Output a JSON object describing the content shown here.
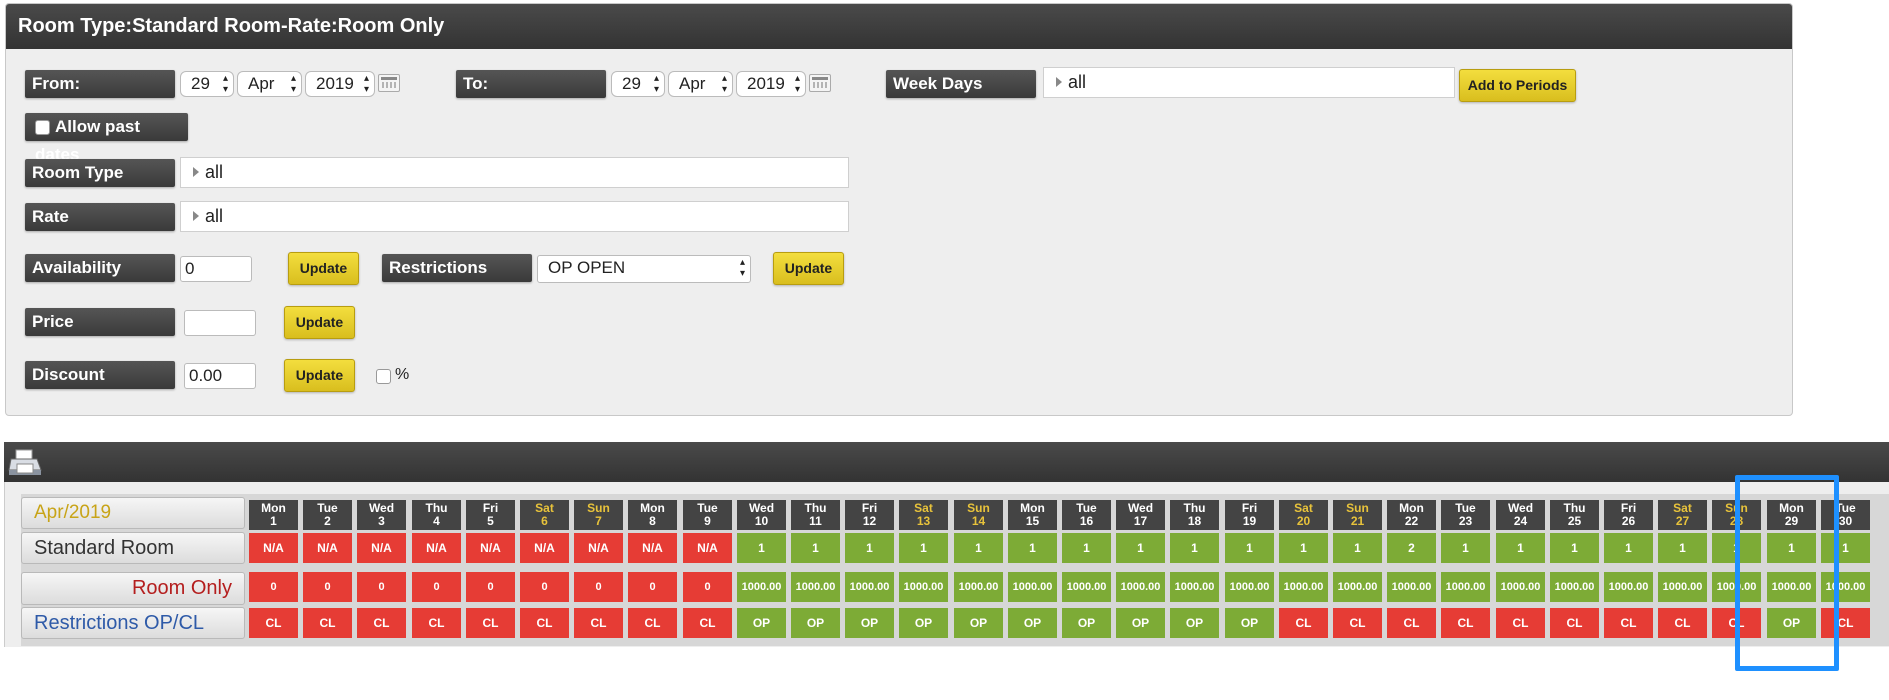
{
  "panel": {
    "title": "Room Type:Standard Room-Rate:Room Only"
  },
  "filters": {
    "from_label": "From:",
    "from_day": "29",
    "from_month": "Apr",
    "from_year": "2019",
    "to_label": "To:",
    "to_day": "29",
    "to_month": "Apr",
    "to_year": "2019",
    "weekdays_label": "Week Days",
    "weekdays_value": "all",
    "add_periods_label": "Add to Periods",
    "allow_past_label": "Allow past dates",
    "room_type_label": "Room Type",
    "room_type_value": "all",
    "rate_label": "Rate",
    "rate_value": "all"
  },
  "update_fields": {
    "availability_label": "Availability",
    "availability_value": "0",
    "update_label": "Update",
    "restrictions_label": "Restrictions",
    "restrictions_value": "OP OPEN",
    "price_label": "Price",
    "price_value": "",
    "discount_label": "Discount",
    "discount_value": "0.00",
    "percent_label": "%"
  },
  "grid": {
    "month_label": "Apr/2019",
    "room_label": "Standard Room",
    "rate_label": "Room Only",
    "restrictions_label": "Restrictions OP/CL",
    "days": [
      {
        "wd": "Mon",
        "d": "1",
        "weekend": false,
        "avail": "N/A",
        "price": "0",
        "rest": "CL"
      },
      {
        "wd": "Tue",
        "d": "2",
        "weekend": false,
        "avail": "N/A",
        "price": "0",
        "rest": "CL"
      },
      {
        "wd": "Wed",
        "d": "3",
        "weekend": false,
        "avail": "N/A",
        "price": "0",
        "rest": "CL"
      },
      {
        "wd": "Thu",
        "d": "4",
        "weekend": false,
        "avail": "N/A",
        "price": "0",
        "rest": "CL"
      },
      {
        "wd": "Fri",
        "d": "5",
        "weekend": false,
        "avail": "N/A",
        "price": "0",
        "rest": "CL"
      },
      {
        "wd": "Sat",
        "d": "6",
        "weekend": true,
        "avail": "N/A",
        "price": "0",
        "rest": "CL"
      },
      {
        "wd": "Sun",
        "d": "7",
        "weekend": true,
        "avail": "N/A",
        "price": "0",
        "rest": "CL"
      },
      {
        "wd": "Mon",
        "d": "8",
        "weekend": false,
        "avail": "N/A",
        "price": "0",
        "rest": "CL"
      },
      {
        "wd": "Tue",
        "d": "9",
        "weekend": false,
        "avail": "N/A",
        "price": "0",
        "rest": "CL"
      },
      {
        "wd": "Wed",
        "d": "10",
        "weekend": false,
        "avail": "1",
        "price": "1000.00",
        "rest": "OP"
      },
      {
        "wd": "Thu",
        "d": "11",
        "weekend": false,
        "avail": "1",
        "price": "1000.00",
        "rest": "OP"
      },
      {
        "wd": "Fri",
        "d": "12",
        "weekend": false,
        "avail": "1",
        "price": "1000.00",
        "rest": "OP"
      },
      {
        "wd": "Sat",
        "d": "13",
        "weekend": true,
        "avail": "1",
        "price": "1000.00",
        "rest": "OP"
      },
      {
        "wd": "Sun",
        "d": "14",
        "weekend": true,
        "avail": "1",
        "price": "1000.00",
        "rest": "OP"
      },
      {
        "wd": "Mon",
        "d": "15",
        "weekend": false,
        "avail": "1",
        "price": "1000.00",
        "rest": "OP"
      },
      {
        "wd": "Tue",
        "d": "16",
        "weekend": false,
        "avail": "1",
        "price": "1000.00",
        "rest": "OP"
      },
      {
        "wd": "Wed",
        "d": "17",
        "weekend": false,
        "avail": "1",
        "price": "1000.00",
        "rest": "OP"
      },
      {
        "wd": "Thu",
        "d": "18",
        "weekend": false,
        "avail": "1",
        "price": "1000.00",
        "rest": "OP"
      },
      {
        "wd": "Fri",
        "d": "19",
        "weekend": false,
        "avail": "1",
        "price": "1000.00",
        "rest": "OP"
      },
      {
        "wd": "Sat",
        "d": "20",
        "weekend": true,
        "avail": "1",
        "price": "1000.00",
        "rest": "CL"
      },
      {
        "wd": "Sun",
        "d": "21",
        "weekend": true,
        "avail": "1",
        "price": "1000.00",
        "rest": "CL"
      },
      {
        "wd": "Mon",
        "d": "22",
        "weekend": false,
        "avail": "2",
        "price": "1000.00",
        "rest": "CL"
      },
      {
        "wd": "Tue",
        "d": "23",
        "weekend": false,
        "avail": "1",
        "price": "1000.00",
        "rest": "CL"
      },
      {
        "wd": "Wed",
        "d": "24",
        "weekend": false,
        "avail": "1",
        "price": "1000.00",
        "rest": "CL"
      },
      {
        "wd": "Thu",
        "d": "25",
        "weekend": false,
        "avail": "1",
        "price": "1000.00",
        "rest": "CL"
      },
      {
        "wd": "Fri",
        "d": "26",
        "weekend": false,
        "avail": "1",
        "price": "1000.00",
        "rest": "CL"
      },
      {
        "wd": "Sat",
        "d": "27",
        "weekend": true,
        "avail": "1",
        "price": "1000.00",
        "rest": "CL"
      },
      {
        "wd": "Sun",
        "d": "28",
        "weekend": true,
        "avail": "1",
        "price": "1000.00",
        "rest": "CL"
      },
      {
        "wd": "Mon",
        "d": "29",
        "weekend": false,
        "avail": "1",
        "price": "1000.00",
        "rest": "OP"
      },
      {
        "wd": "Tue",
        "d": "30",
        "weekend": false,
        "avail": "1",
        "price": "1000.00",
        "rest": "CL"
      }
    ]
  },
  "colors": {
    "closed": "#e63c35",
    "open": "#7dab36",
    "weekend_text": "#e8c33b",
    "highlight": "#1e90ff",
    "button": "#e6cd2c"
  }
}
